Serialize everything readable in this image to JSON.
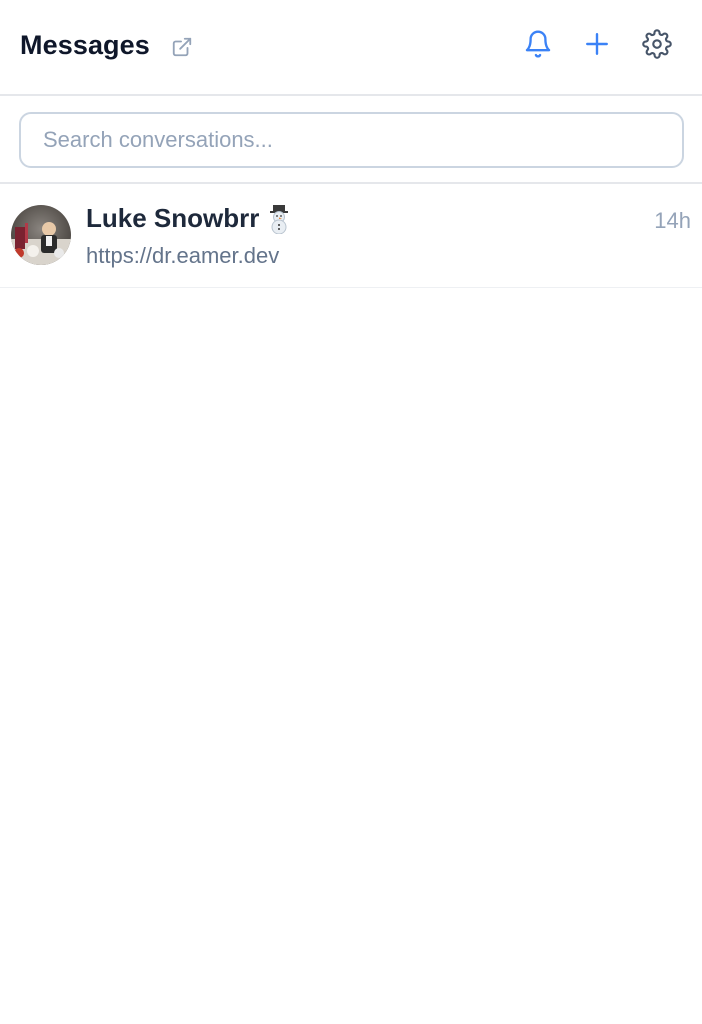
{
  "header": {
    "title": "Messages",
    "popout_icon": "external-link-icon",
    "actions": [
      {
        "name": "notifications",
        "icon": "bell-icon"
      },
      {
        "name": "new-message",
        "icon": "plus-icon"
      },
      {
        "name": "settings",
        "icon": "gear-icon"
      }
    ]
  },
  "search": {
    "placeholder": "Search conversations...",
    "value": ""
  },
  "conversations": [
    {
      "name": "Luke Snowbrr",
      "name_emoji": "snowman-icon",
      "time": "14h",
      "preview": "https://dr.eamer.dev"
    }
  ],
  "colors": {
    "accent": "#3b82f6",
    "title": "#0f172a",
    "muted": "#94a3b8",
    "preview": "#64748b",
    "divider": "#e5e7eb"
  }
}
